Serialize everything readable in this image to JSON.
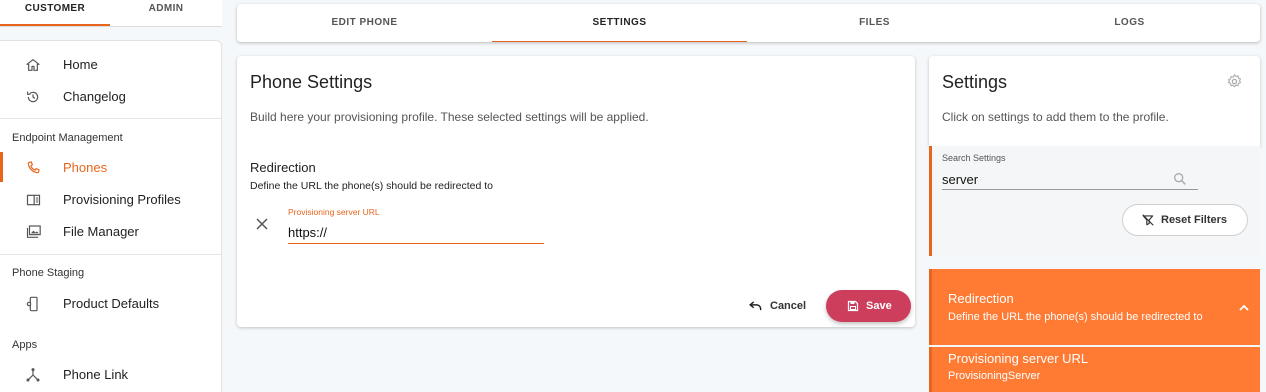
{
  "top_tabs": {
    "customer": "CUSTOMER",
    "admin": "ADMIN"
  },
  "sidebar": {
    "items": [
      {
        "label": "Home",
        "icon": "home-icon"
      },
      {
        "label": "Changelog",
        "icon": "history-icon"
      },
      {
        "label": "Phones",
        "icon": "phone-icon",
        "active": true
      },
      {
        "label": "Provisioning Profiles",
        "icon": "profile-icon"
      },
      {
        "label": "File Manager",
        "icon": "folder-image-icon"
      },
      {
        "label": "Product Defaults",
        "icon": "device-settings-icon"
      },
      {
        "label": "Phone Link",
        "icon": "link-network-icon"
      }
    ],
    "sections": {
      "endpoint": "Endpoint Management",
      "staging": "Phone Staging",
      "apps": "Apps"
    }
  },
  "tabs": [
    "EDIT PHONE",
    "SETTINGS",
    "FILES",
    "LOGS"
  ],
  "active_tab": "SETTINGS",
  "phone_settings": {
    "title": "Phone Settings",
    "description": "Build here your provisioning profile. These selected settings will be applied.",
    "redirection_title": "Redirection",
    "redirection_subtitle": "Define the URL the phone(s) should be redirected to",
    "field_label": "Provisioning server URL",
    "field_value": "https://",
    "cancel_label": "Cancel",
    "save_label": "Save"
  },
  "settings_panel": {
    "title": "Settings",
    "description": "Click on settings to add them to the profile.",
    "search_label": "Search Settings",
    "search_value": "server",
    "reset_label": "Reset Filters",
    "results": [
      {
        "title": "Redirection",
        "subtitle": "Define the URL the phone(s) should be redirected to"
      },
      {
        "title": "Provisioning server URL",
        "subtitle": "ProvisioningServer"
      }
    ]
  },
  "colors": {
    "accent": "#e8651d",
    "save": "#cd3d5c",
    "result_bg": "#ff7a33"
  }
}
